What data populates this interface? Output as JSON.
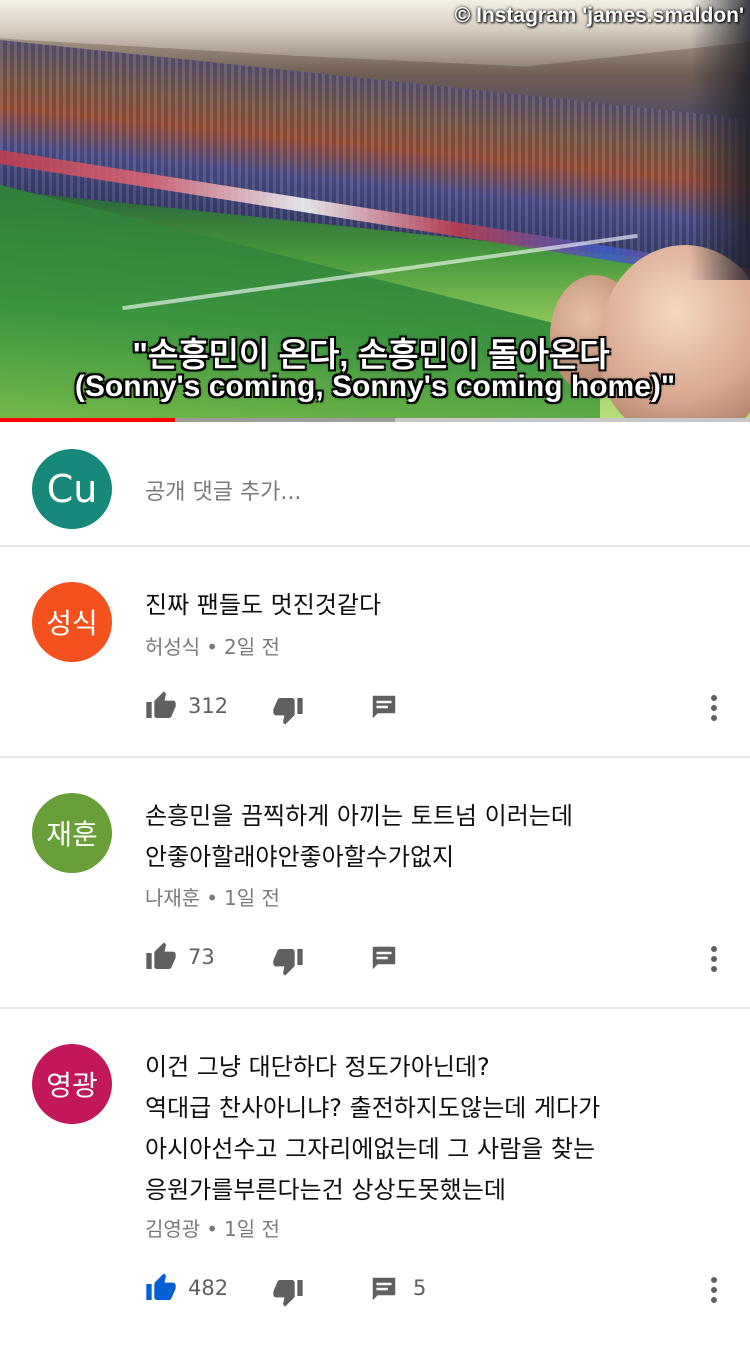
{
  "video": {
    "credit": "© Instagram 'james.smaldon'",
    "subtitle_line1": "\"손흥민이 온다, 손흥민이 돌아온다",
    "subtitle_line2": "(Sonny's coming, Sonny's coming home)\"",
    "progress_played_fraction": 0.233,
    "progress_buffered_fraction": 0.527
  },
  "add_comment": {
    "avatar_initials": "Cu",
    "avatar_color": "#16897a",
    "placeholder": "공개 댓글 추가..."
  },
  "comments": [
    {
      "avatar_text": "성식",
      "avatar_color": "#f4511e",
      "lines": [
        "진짜 팬들도 멋진것같다"
      ],
      "author": "허성식",
      "time": "2일 전",
      "likes": "312",
      "liked": false,
      "replies": ""
    },
    {
      "avatar_text": "재훈",
      "avatar_color": "#689f38",
      "lines": [
        "손흥민을 끔찍하게 아끼는 토트넘 이러는데",
        "안좋아할래야안좋아할수가없지"
      ],
      "author": "나재훈",
      "time": "1일 전",
      "likes": "73",
      "liked": false,
      "replies": ""
    },
    {
      "avatar_text": "영광",
      "avatar_color": "#c2185b",
      "lines": [
        "이건 그냥 대단하다 정도가아닌데?",
        "역대급 찬사아니냐? 출전하지도않는데 게다가",
        "아시아선수고 그자리에없는데 그 사람을 찾는",
        "응원가를부른다는건 상상도못했는데"
      ],
      "author": "김영광",
      "time": "1일 전",
      "likes": "482",
      "liked": true,
      "replies": "5"
    }
  ],
  "colors": {
    "icon_gray": "#606060",
    "liked_blue": "#065fd4",
    "progress_red": "#ff0000"
  },
  "icons": {
    "like": "thumb-up-icon",
    "dislike": "thumb-down-icon",
    "reply": "comment-icon",
    "more": "more-vertical-icon"
  }
}
